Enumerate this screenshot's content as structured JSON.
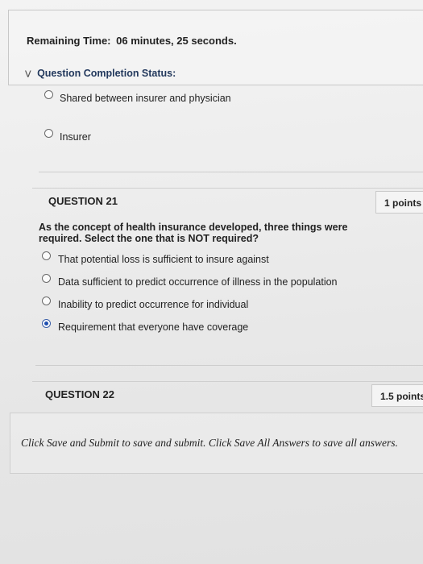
{
  "timer": {
    "label": "Remaining Time:",
    "value": "06 minutes, 25 seconds."
  },
  "completion_status": {
    "label": "Question Completion Status:"
  },
  "previous_question": {
    "options": [
      "Shared between insurer and physician",
      "Insurer"
    ]
  },
  "question_21": {
    "title": "QUESTION 21",
    "points": "1 points",
    "text": "As the concept of health insurance developed, three things were required. Select the one that is NOT required?",
    "options": [
      "That potential loss is sufficient to insure against",
      "Data sufficient to predict occurrence of illness in the population",
      "Inability to predict occurrence for individual",
      "Requirement that everyone have coverage"
    ],
    "selected_index": 3
  },
  "question_22": {
    "title": "QUESTION 22",
    "points": "1.5 points"
  },
  "footer": {
    "instruction": "Click Save and Submit to save and submit. Click Save All Answers to save all answers."
  },
  "colors": {
    "selected_radio": "#1f4fb0",
    "status_label": "#23395d"
  },
  "icons": {
    "completion_toggle": "chevron-down-icon"
  }
}
